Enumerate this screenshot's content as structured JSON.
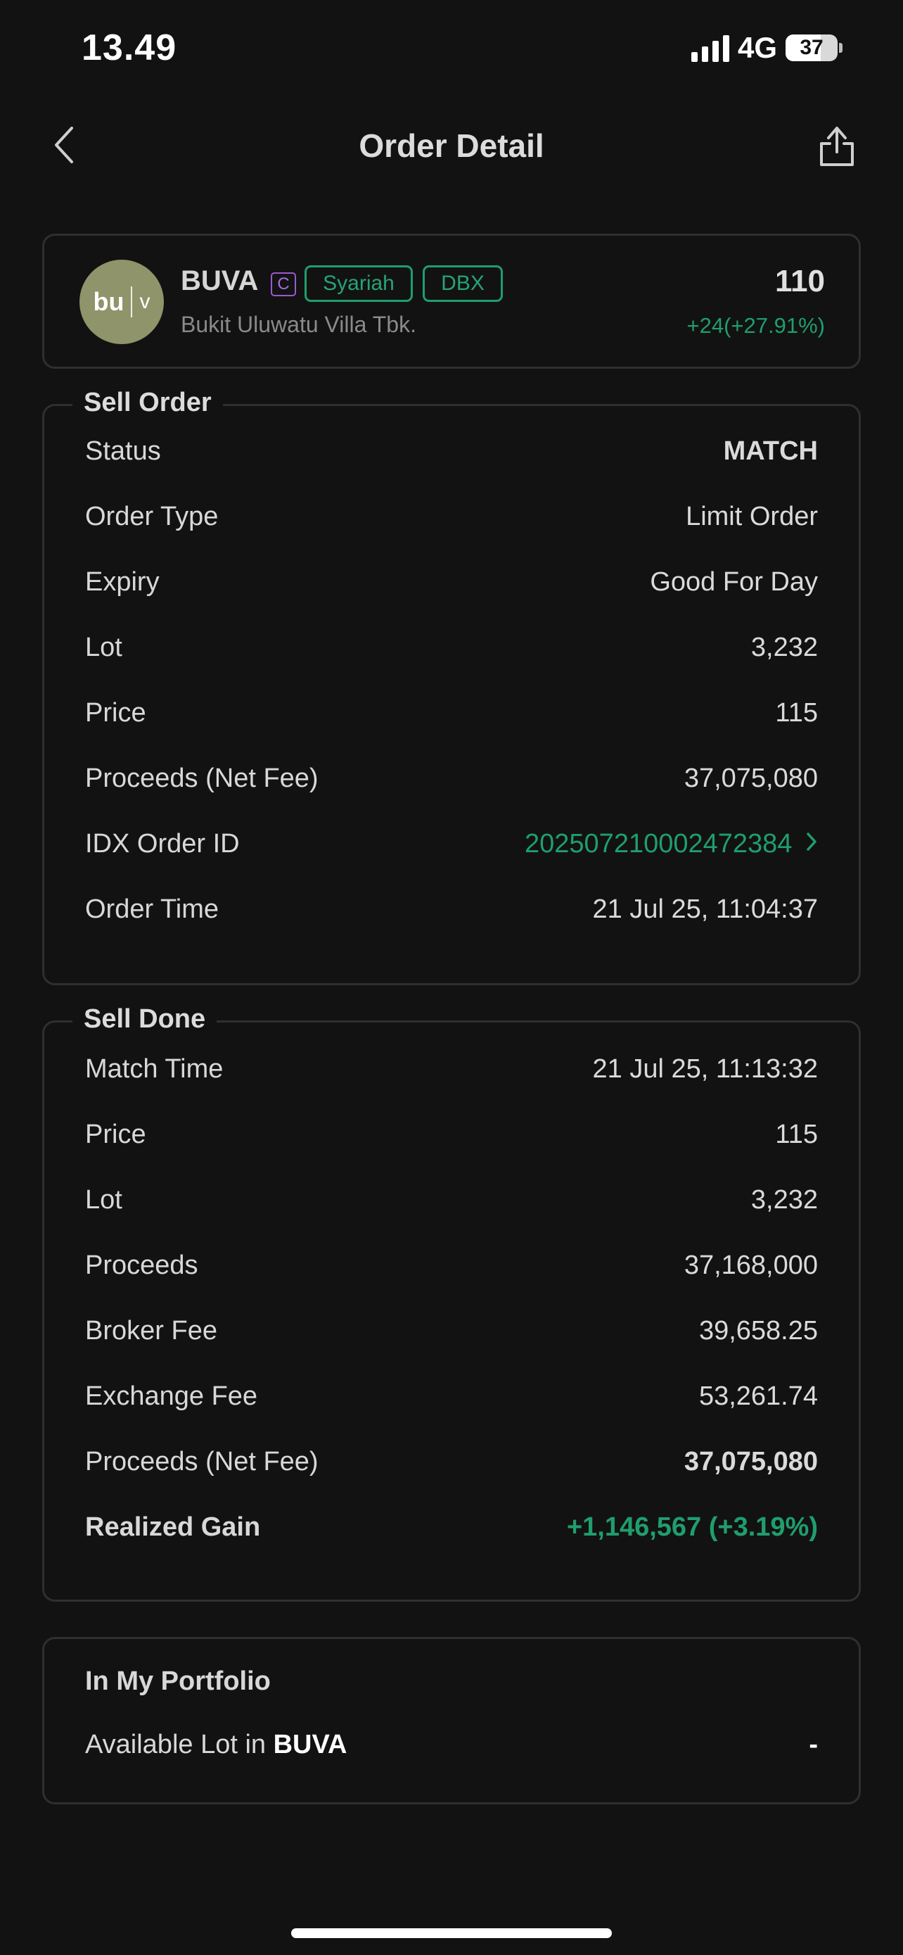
{
  "status_bar": {
    "time": "13.49",
    "network": "4G",
    "battery": "37"
  },
  "header": {
    "title": "Order Detail"
  },
  "stock": {
    "logo_text_left": "bu",
    "logo_text_right": "v",
    "ticker": "BUVA",
    "badge_c": "C",
    "tags": [
      "Syariah",
      "DBX"
    ],
    "company": "Bukit Uluwatu Villa Tbk.",
    "price": "110",
    "change": "+24(+27.91%)"
  },
  "sell_order": {
    "title": "Sell Order",
    "rows": [
      {
        "label": "Status",
        "value": "MATCH"
      },
      {
        "label": "Order Type",
        "value": "Limit Order"
      },
      {
        "label": "Expiry",
        "value": "Good For Day"
      },
      {
        "label": "Lot",
        "value": "3,232"
      },
      {
        "label": "Price",
        "value": "115"
      },
      {
        "label": "Proceeds (Net Fee)",
        "value": "37,075,080"
      },
      {
        "label": "IDX Order ID",
        "value": "202507210002472384"
      },
      {
        "label": "Order Time",
        "value": "21 Jul 25, 11:04:37"
      }
    ]
  },
  "sell_done": {
    "title": "Sell Done",
    "rows": [
      {
        "label": "Match Time",
        "value": "21 Jul 25, 11:13:32"
      },
      {
        "label": "Price",
        "value": "115"
      },
      {
        "label": "Lot",
        "value": "3,232"
      },
      {
        "label": "Proceeds",
        "value": "37,168,000"
      },
      {
        "label": "Broker Fee",
        "value": "39,658.25"
      },
      {
        "label": "Exchange Fee",
        "value": "53,261.74"
      },
      {
        "label": "Proceeds (Net Fee)",
        "value": "37,075,080"
      },
      {
        "label": "Realized Gain",
        "value": "+1,146,567 (+3.19%)"
      }
    ]
  },
  "portfolio": {
    "title": "In My Portfolio",
    "label_prefix": "Available Lot in ",
    "label_ticker": "BUVA",
    "value": "-"
  },
  "colors": {
    "accent_green": "#1f9e6e",
    "background": "#121212",
    "card_border": "#2f2f2f"
  }
}
